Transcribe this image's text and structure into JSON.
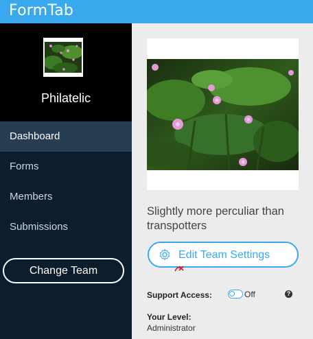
{
  "app": {
    "title": "FormTab"
  },
  "sidebar": {
    "team_name": "Philatelic",
    "items": [
      {
        "label": "Dashboard",
        "active": true
      },
      {
        "label": "Forms"
      },
      {
        "label": "Members"
      },
      {
        "label": "Submissions"
      }
    ],
    "change_team_label": "Change Team"
  },
  "team": {
    "description": "Slightly more perculiar than transpotters",
    "edit_settings_label": "Edit Team Settings",
    "support_access_label": "Support Access:",
    "support_access_value": "Off",
    "your_level_label": "Your Level:",
    "your_level_value": "Administrator"
  },
  "colors": {
    "accent": "#3aa8ec",
    "sidebar": "#0c1d2b",
    "sidebar_active": "#273e52",
    "team_header": "#000000"
  }
}
